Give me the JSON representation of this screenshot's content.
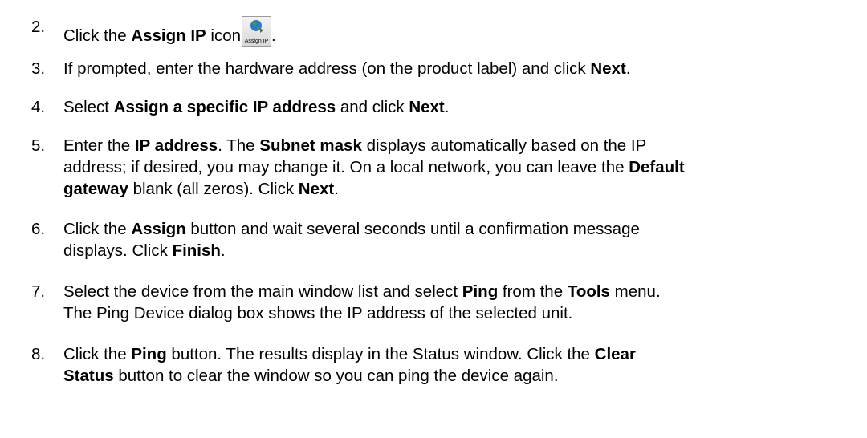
{
  "steps": [
    {
      "num": "2.",
      "parts": [
        "Click the ",
        "Assign IP",
        " icon",
        "."
      ],
      "icon_caption": "Assign IP",
      "icon_name": "assign-ip-globe-icon"
    },
    {
      "num": "3.",
      "parts": [
        "If prompted, enter the hardware address (on the product label) and click ",
        "Next",
        "."
      ]
    },
    {
      "num": "4.",
      "parts": [
        "Select ",
        "Assign a specific IP address",
        " and click ",
        "Next",
        "."
      ]
    },
    {
      "num": "5.",
      "lines": [
        [
          "Enter the ",
          "IP address",
          ". The ",
          "Subnet mask",
          " displays automatically based on the IP"
        ],
        [
          "address; if desired, you may change it. On a local network, you can leave the ",
          "Default"
        ],
        [
          "gateway",
          " blank (all zeros). Click ",
          "Next",
          "."
        ]
      ]
    },
    {
      "num": "6.",
      "lines": [
        [
          "Click the ",
          "Assign",
          " button and wait several seconds until a confirmation message"
        ],
        [
          "displays. Click ",
          "Finish",
          "."
        ]
      ]
    },
    {
      "num": "7.",
      "lines": [
        [
          "Select the device from the main window list and select ",
          "Ping",
          " from the ",
          "Tools",
          " menu."
        ],
        [
          "The Ping Device dialog box shows the IP address of the selected unit."
        ]
      ]
    },
    {
      "num": "8.",
      "lines": [
        [
          "Click the ",
          "Ping",
          " button. The results display in the Status window. Click the ",
          "Clear"
        ],
        [
          "Status",
          " button to clear the window so you can ping the device again."
        ]
      ]
    }
  ]
}
